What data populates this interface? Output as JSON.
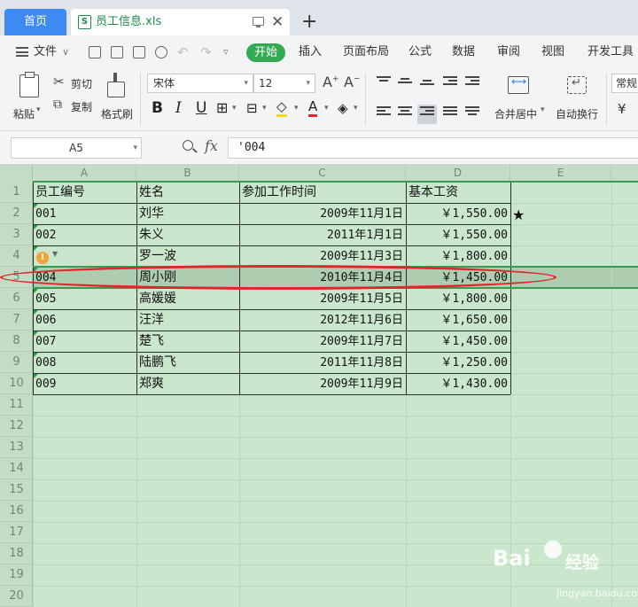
{
  "tabs": {
    "home": "首页",
    "file": "员工信息.xls"
  },
  "menu": {
    "file": "文件",
    "items": [
      "开始",
      "插入",
      "页面布局",
      "公式",
      "数据",
      "审阅",
      "视图",
      "开发工具"
    ]
  },
  "ribbon": {
    "paste": "粘贴",
    "cut": "剪切",
    "copy": "复制",
    "format_painter": "格式刷",
    "font_name": "宋体",
    "font_size": "12",
    "merge_center": "合并居中",
    "wrap_text": "自动换行",
    "number_format": "常规",
    "currency_symbol": "¥"
  },
  "formula_bar": {
    "name_box": "A5",
    "fx": "fx",
    "value": "'004"
  },
  "sheet": {
    "columns": [
      "A",
      "B",
      "C",
      "D",
      "E"
    ],
    "rows": [
      "1",
      "2",
      "3",
      "4",
      "5",
      "6",
      "7",
      "8",
      "9",
      "10",
      "11",
      "12",
      "13",
      "14",
      "15",
      "16",
      "17",
      "18",
      "19",
      "20"
    ],
    "header": [
      "员工编号",
      "姓名",
      "参加工作时间",
      "基本工资"
    ],
    "data": [
      [
        "001",
        "刘华",
        "2009年11月1日",
        "￥1,550.00"
      ],
      [
        "002",
        "朱义",
        "2011年1月1日",
        "￥1,550.00"
      ],
      [
        "",
        "罗一波",
        "2009年11月3日",
        "￥1,800.00"
      ],
      [
        "004",
        "周小刚",
        "2010年11月4日",
        "￥1,450.00"
      ],
      [
        "005",
        "高媛媛",
        "2009年11月5日",
        "￥1,800.00"
      ],
      [
        "006",
        "汪洋",
        "2012年11月6日",
        "￥1,650.00"
      ],
      [
        "007",
        "楚飞",
        "2009年11月7日",
        "￥1,450.00"
      ],
      [
        "008",
        "陆鹏飞",
        "2011年11月8日",
        "￥1,250.00"
      ],
      [
        "009",
        "郑爽",
        "2009年11月9日",
        "￥1,430.00"
      ]
    ],
    "selected_cell": "A5",
    "star": "★"
  },
  "watermark": {
    "brand": "Bai",
    "brand_cn": "经验",
    "url": "jingyan.baidu.com"
  },
  "colors": {
    "accent_green": "#34a853",
    "home_tab": "#3d8bf2",
    "sheet_bg": "#cae7cd",
    "highlight_circle": "#e0242a"
  }
}
